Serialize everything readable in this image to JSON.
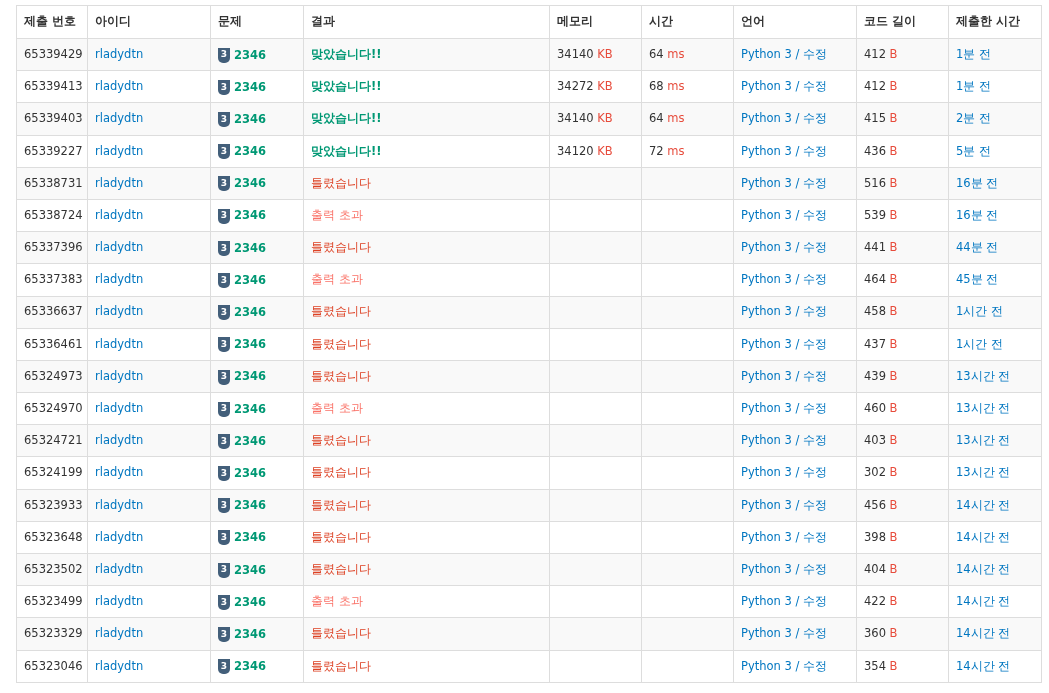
{
  "columns": [
    "제출 번호",
    "아이디",
    "문제",
    "결과",
    "메모리",
    "시간",
    "언어",
    "코드 길이",
    "제출한 시간"
  ],
  "rows": [
    {
      "id": "65339429",
      "user": "rladydtn",
      "tier": "3",
      "problem": "2346",
      "result": {
        "text": "맞았습니다!!",
        "kind": "accepted"
      },
      "memory": "34140",
      "memory_unit": "KB",
      "time": "64",
      "time_unit": "ms",
      "language": "Python 3 / 수정",
      "length": "412",
      "length_unit": "B",
      "submitted": "1분 전"
    },
    {
      "id": "65339413",
      "user": "rladydtn",
      "tier": "3",
      "problem": "2346",
      "result": {
        "text": "맞았습니다!!",
        "kind": "accepted"
      },
      "memory": "34272",
      "memory_unit": "KB",
      "time": "68",
      "time_unit": "ms",
      "language": "Python 3 / 수정",
      "length": "412",
      "length_unit": "B",
      "submitted": "1분 전"
    },
    {
      "id": "65339403",
      "user": "rladydtn",
      "tier": "3",
      "problem": "2346",
      "result": {
        "text": "맞았습니다!!",
        "kind": "accepted"
      },
      "memory": "34140",
      "memory_unit": "KB",
      "time": "64",
      "time_unit": "ms",
      "language": "Python 3 / 수정",
      "length": "415",
      "length_unit": "B",
      "submitted": "2분 전"
    },
    {
      "id": "65339227",
      "user": "rladydtn",
      "tier": "3",
      "problem": "2346",
      "result": {
        "text": "맞았습니다!!",
        "kind": "accepted"
      },
      "memory": "34120",
      "memory_unit": "KB",
      "time": "72",
      "time_unit": "ms",
      "language": "Python 3 / 수정",
      "length": "436",
      "length_unit": "B",
      "submitted": "5분 전"
    },
    {
      "id": "65338731",
      "user": "rladydtn",
      "tier": "3",
      "problem": "2346",
      "result": {
        "text": "틀렸습니다",
        "kind": "wrong"
      },
      "language": "Python 3 / 수정",
      "length": "516",
      "length_unit": "B",
      "submitted": "16분 전"
    },
    {
      "id": "65338724",
      "user": "rladydtn",
      "tier": "3",
      "problem": "2346",
      "result": {
        "text": "출력 초과",
        "kind": "output_limit"
      },
      "language": "Python 3 / 수정",
      "length": "539",
      "length_unit": "B",
      "submitted": "16분 전"
    },
    {
      "id": "65337396",
      "user": "rladydtn",
      "tier": "3",
      "problem": "2346",
      "result": {
        "text": "틀렸습니다",
        "kind": "wrong"
      },
      "language": "Python 3 / 수정",
      "length": "441",
      "length_unit": "B",
      "submitted": "44분 전"
    },
    {
      "id": "65337383",
      "user": "rladydtn",
      "tier": "3",
      "problem": "2346",
      "result": {
        "text": "출력 초과",
        "kind": "output_limit"
      },
      "language": "Python 3 / 수정",
      "length": "464",
      "length_unit": "B",
      "submitted": "45분 전"
    },
    {
      "id": "65336637",
      "user": "rladydtn",
      "tier": "3",
      "problem": "2346",
      "result": {
        "text": "틀렸습니다",
        "kind": "wrong"
      },
      "language": "Python 3 / 수정",
      "length": "458",
      "length_unit": "B",
      "submitted": "1시간 전"
    },
    {
      "id": "65336461",
      "user": "rladydtn",
      "tier": "3",
      "problem": "2346",
      "result": {
        "text": "틀렸습니다",
        "kind": "wrong"
      },
      "language": "Python 3 / 수정",
      "length": "437",
      "length_unit": "B",
      "submitted": "1시간 전"
    },
    {
      "id": "65324973",
      "user": "rladydtn",
      "tier": "3",
      "problem": "2346",
      "result": {
        "text": "틀렸습니다",
        "kind": "wrong"
      },
      "language": "Python 3 / 수정",
      "length": "439",
      "length_unit": "B",
      "submitted": "13시간 전"
    },
    {
      "id": "65324970",
      "user": "rladydtn",
      "tier": "3",
      "problem": "2346",
      "result": {
        "text": "출력 초과",
        "kind": "output_limit"
      },
      "language": "Python 3 / 수정",
      "length": "460",
      "length_unit": "B",
      "submitted": "13시간 전"
    },
    {
      "id": "65324721",
      "user": "rladydtn",
      "tier": "3",
      "problem": "2346",
      "result": {
        "text": "틀렸습니다",
        "kind": "wrong"
      },
      "language": "Python 3 / 수정",
      "length": "403",
      "length_unit": "B",
      "submitted": "13시간 전"
    },
    {
      "id": "65324199",
      "user": "rladydtn",
      "tier": "3",
      "problem": "2346",
      "result": {
        "text": "틀렸습니다",
        "kind": "wrong"
      },
      "language": "Python 3 / 수정",
      "length": "302",
      "length_unit": "B",
      "submitted": "13시간 전"
    },
    {
      "id": "65323933",
      "user": "rladydtn",
      "tier": "3",
      "problem": "2346",
      "result": {
        "text": "틀렸습니다",
        "kind": "wrong"
      },
      "language": "Python 3 / 수정",
      "length": "456",
      "length_unit": "B",
      "submitted": "14시간 전"
    },
    {
      "id": "65323648",
      "user": "rladydtn",
      "tier": "3",
      "problem": "2346",
      "result": {
        "text": "틀렸습니다",
        "kind": "wrong"
      },
      "language": "Python 3 / 수정",
      "length": "398",
      "length_unit": "B",
      "submitted": "14시간 전"
    },
    {
      "id": "65323502",
      "user": "rladydtn",
      "tier": "3",
      "problem": "2346",
      "result": {
        "text": "틀렸습니다",
        "kind": "wrong"
      },
      "language": "Python 3 / 수정",
      "length": "404",
      "length_unit": "B",
      "submitted": "14시간 전"
    },
    {
      "id": "65323499",
      "user": "rladydtn",
      "tier": "3",
      "problem": "2346",
      "result": {
        "text": "출력 초과",
        "kind": "output_limit"
      },
      "language": "Python 3 / 수정",
      "length": "422",
      "length_unit": "B",
      "submitted": "14시간 전"
    },
    {
      "id": "65323329",
      "user": "rladydtn",
      "tier": "3",
      "problem": "2346",
      "result": {
        "text": "틀렸습니다",
        "kind": "wrong"
      },
      "language": "Python 3 / 수정",
      "length": "360",
      "length_unit": "B",
      "submitted": "14시간 전"
    },
    {
      "id": "65323046",
      "user": "rladydtn",
      "tier": "3",
      "problem": "2346",
      "result": {
        "text": "틀렸습니다",
        "kind": "wrong"
      },
      "language": "Python 3 / 수정",
      "length": "354",
      "length_unit": "B",
      "submitted": "14시간 전"
    }
  ]
}
